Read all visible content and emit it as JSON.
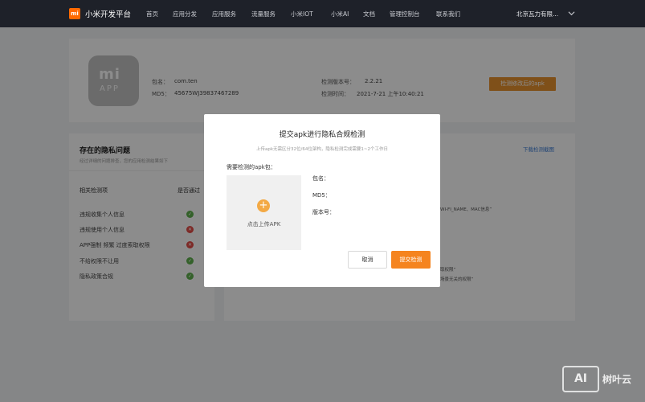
{
  "nav": {
    "logo_text": "mi",
    "brand": "小米开发平台",
    "items": [
      "首页",
      "应用分发",
      "应用服务",
      "流量服务",
      "小米IOT",
      "小米AI",
      "文档",
      "管理控制台",
      "联系我们"
    ],
    "company": "北京瓦力有限...",
    "background": "#1e2129",
    "logo_color": "#ff6900"
  },
  "app": {
    "icon_mi": "mi",
    "icon_app": "APP",
    "package_label": "包名：",
    "package_value": "com.ten",
    "md5_label": "MD5：",
    "md5_value": "45675WJ39837467289",
    "version_label": "检测版本号：",
    "version_value": "2.2.21",
    "time_label": "检测时间：",
    "time_value": "2021-7-21 上午10:40:21",
    "action_button": "检测修改后的apk",
    "action_color": "#e7922f"
  },
  "privacy": {
    "title": "存在的隐私问题",
    "subtitle": "经过详细的问题排查，您的应用检测结果如下",
    "col_item": "相关检测项",
    "col_pass": "是否通过",
    "checks": [
      {
        "label": "违规收集个人信息",
        "status": "pass"
      },
      {
        "label": "违规使用个人信息",
        "status": "fail"
      },
      {
        "label": "APP强制 频繁 过度索取权限",
        "status": "fail"
      },
      {
        "label": "不给权限不让用",
        "status": "pass"
      },
      {
        "label": "隐私政策合规",
        "status": "pass"
      }
    ],
    "download_link": "下载检测截图",
    "bg_line1": "WI-FI_NAME、MAC信息”",
    "bg_line2": "取权限”",
    "bg_line3": "场景无关的权限”",
    "pass_color": "#5fb14e",
    "fail_color": "#e34b45"
  },
  "modal": {
    "title": "提交apk进行隐私合规检测",
    "subtitle": "上传apk无需区分32位/64位架构，隐私检测完成需要1~2个工作日",
    "upload_label": "需要检测的apk包：",
    "upload_text": "点击上传APK",
    "info_package": "包名：",
    "info_md5": "MD5：",
    "info_version": "版本号：",
    "cancel": "取消",
    "submit": "提交检测",
    "submit_color": "#f5841f"
  },
  "watermark": {
    "badge": "AI",
    "text": "树叶云"
  }
}
